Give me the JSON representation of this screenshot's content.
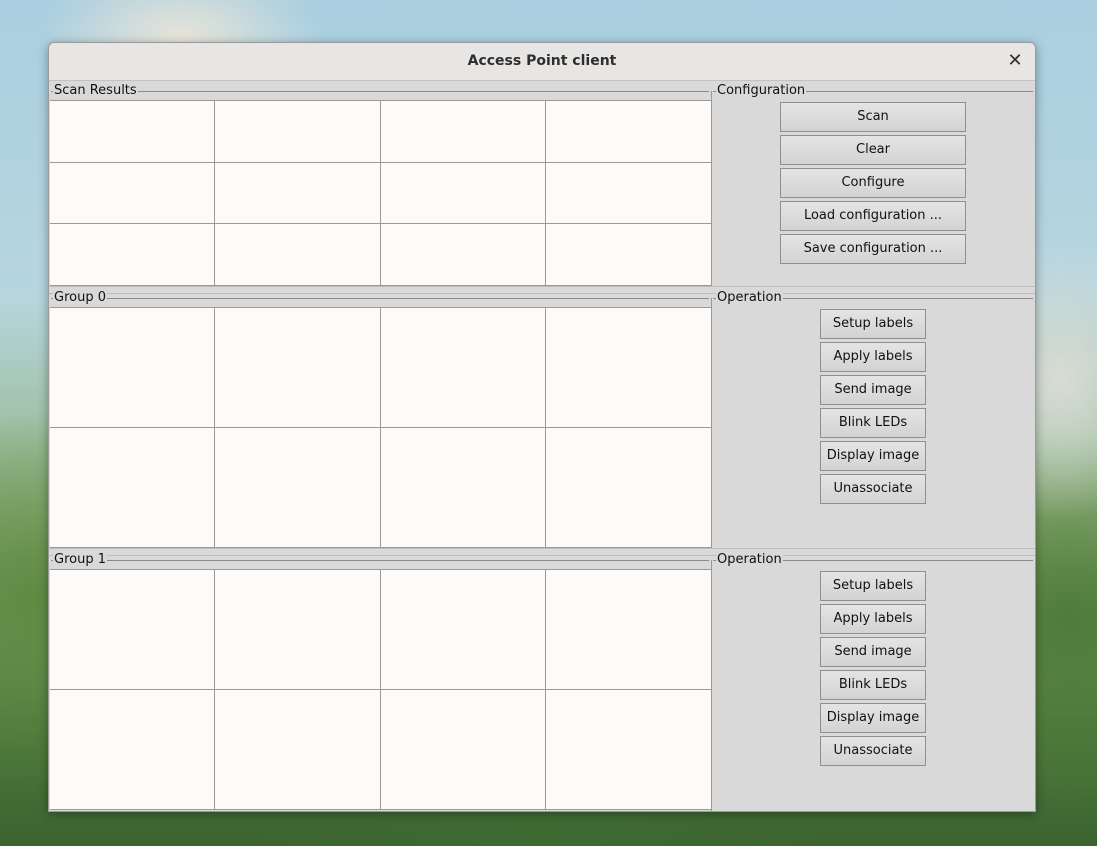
{
  "window": {
    "title": "Access Point client"
  },
  "scan_results": {
    "label": "Scan Results",
    "rows": 3,
    "cols": 4
  },
  "configuration": {
    "label": "Configuration",
    "buttons": [
      "Scan",
      "Clear",
      "Configure",
      "Load configuration ...",
      "Save configuration ..."
    ]
  },
  "groups": [
    {
      "label": "Group 0",
      "operation_label": "Operation",
      "buttons": [
        "Setup labels",
        "Apply labels",
        "Send image",
        "Blink LEDs",
        "Display image",
        "Unassociate"
      ]
    },
    {
      "label": "Group 1",
      "operation_label": "Operation",
      "buttons": [
        "Setup labels",
        "Apply labels",
        "Send image",
        "Blink LEDs",
        "Display image",
        "Unassociate"
      ]
    }
  ]
}
